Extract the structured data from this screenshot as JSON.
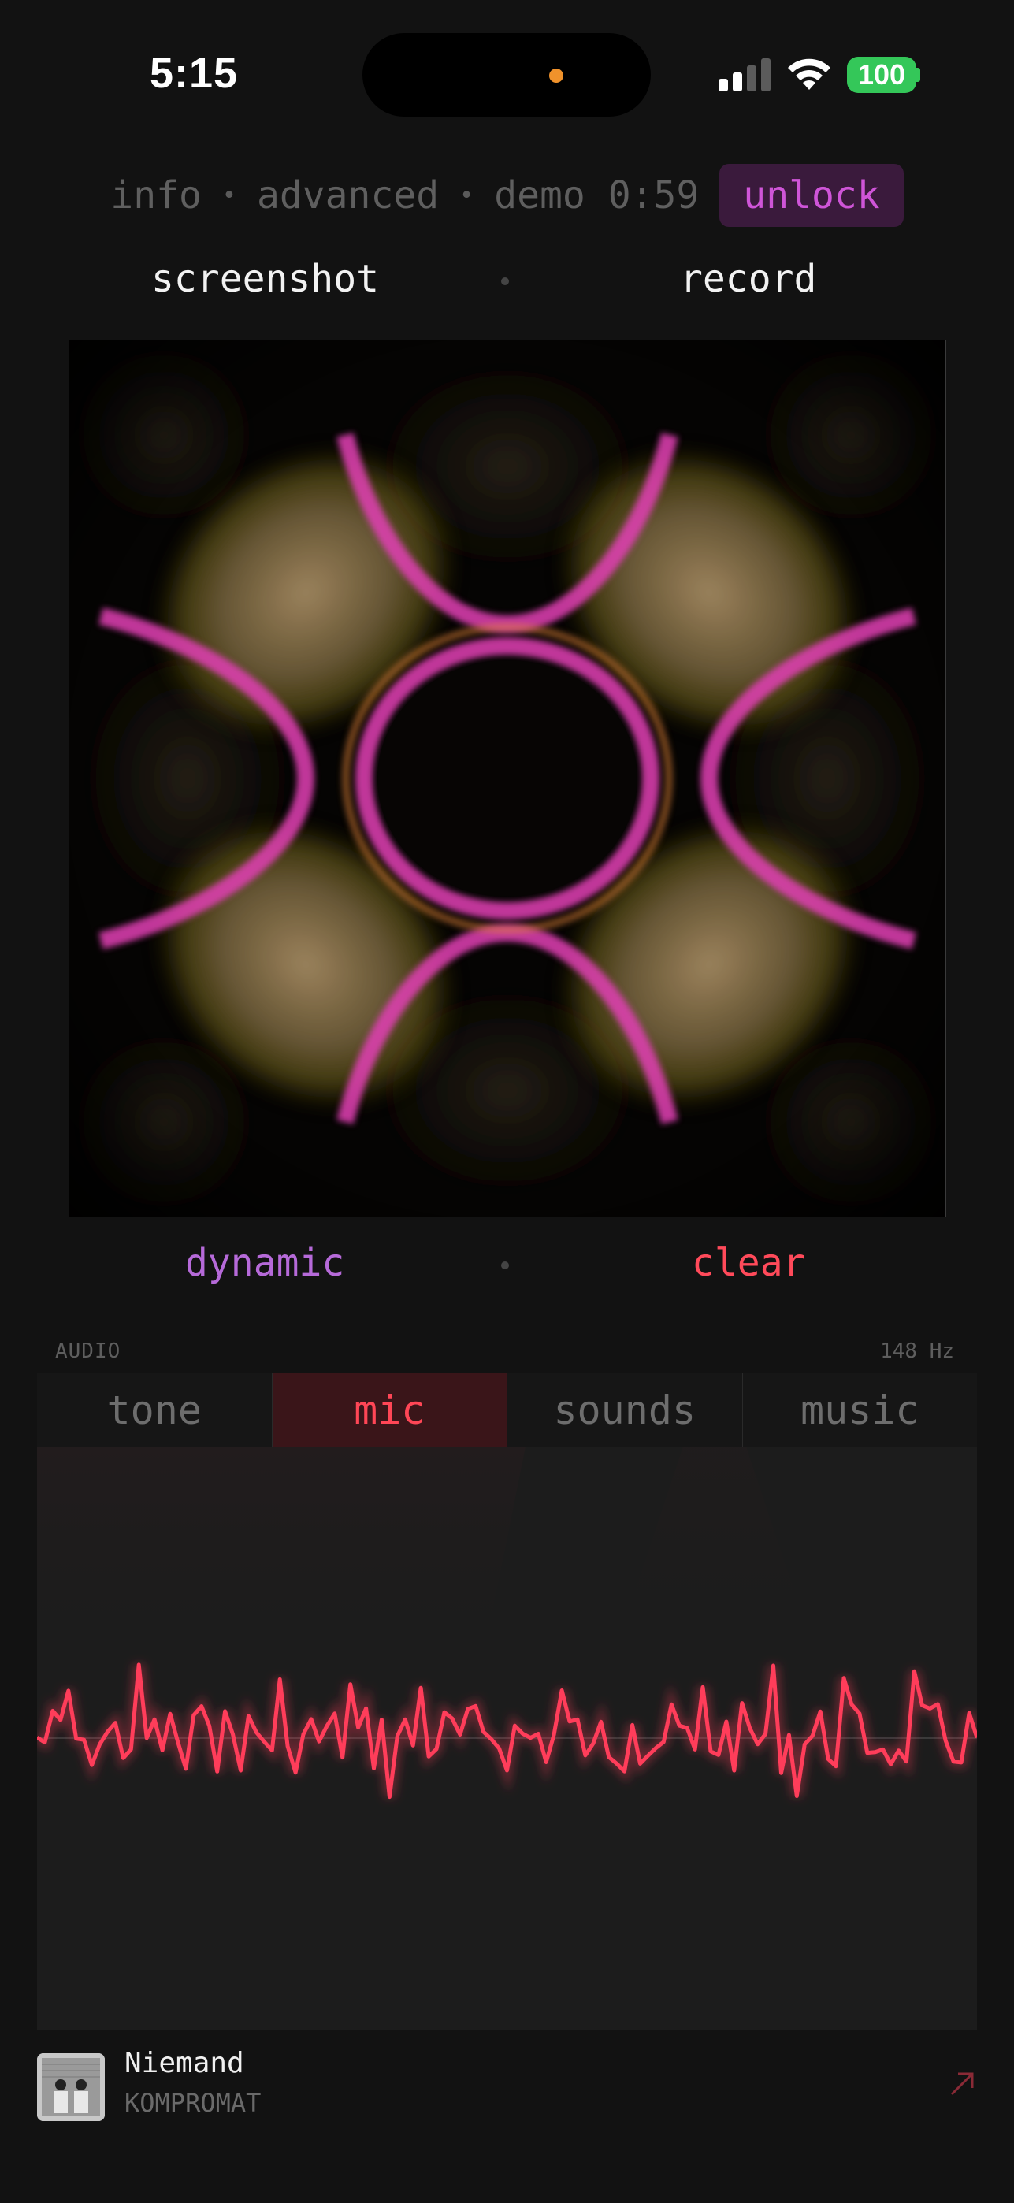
{
  "status": {
    "time": "5:15",
    "battery": "100"
  },
  "nav": {
    "info": "info",
    "advanced": "advanced",
    "demo": "demo 0:59",
    "unlock": "unlock",
    "separator": "•"
  },
  "actions": {
    "screenshot": "screenshot",
    "record": "record"
  },
  "modes": {
    "dynamic": "dynamic",
    "clear": "clear"
  },
  "audio": {
    "section_label": "AUDIO",
    "frequency": "148 Hz",
    "tabs": [
      "tone",
      "mic",
      "sounds",
      "music"
    ],
    "active_tab": "mic"
  },
  "now_playing": {
    "title": "Niemand",
    "artist": "KOMPROMAT"
  },
  "colors": {
    "accent_magenta": "#cf55d8",
    "accent_red": "#ff4656",
    "particle_gold": "#c9a869",
    "particle_pink": "#e43fb5",
    "battery_green": "#34c759"
  },
  "icons": {
    "signal": "cellular-signal-icon",
    "wifi": "wifi-icon",
    "open_link": "arrow-up-right-icon"
  }
}
